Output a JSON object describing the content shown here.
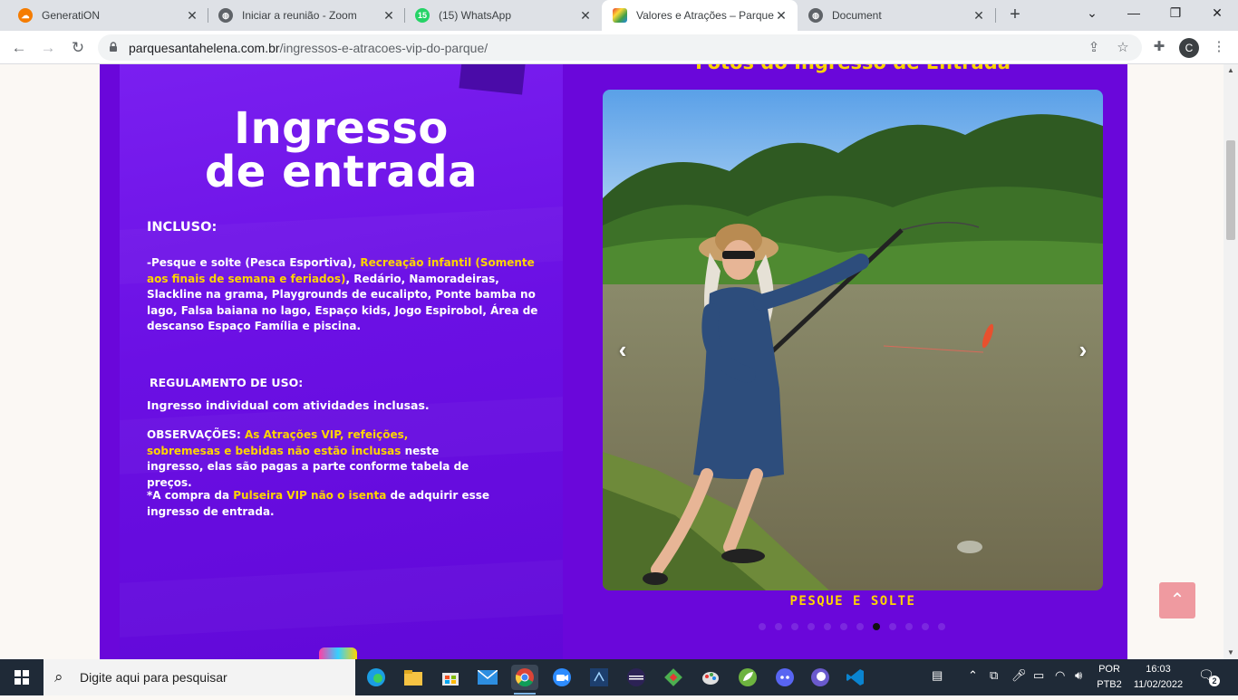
{
  "browser": {
    "tabs": [
      {
        "title": "GeneratiON",
        "icon": "cloud-icon",
        "color": "#f57c00"
      },
      {
        "title": "Iniciar a reunião - Zoom",
        "icon": "globe-icon",
        "color": "#5f6368"
      },
      {
        "title": "(15) WhatsApp",
        "icon": "whatsapp-icon",
        "color": "#25d366",
        "badge": "15"
      },
      {
        "title": "Valores e Atrações – Parque Sa",
        "icon": "park-logo-icon",
        "color": "#e53935"
      },
      {
        "title": "Document",
        "icon": "globe-icon",
        "color": "#5f6368"
      }
    ],
    "active_tab": 3,
    "new_tab_label": "+",
    "url_host": "parquesantahelena.com.br",
    "url_path": "/ingressos-e-atracoes-vip-do-parque/",
    "profile_initial": "C"
  },
  "page": {
    "photo_heading": "Fotos do Ingresso de Entrada",
    "promo": {
      "title_line1": "Ingresso",
      "title_line2": "de entrada",
      "incluso_heading": "INCLUSO:",
      "incluso_p1": "-Pesque e solte ",
      "incluso_p2": "(Pesca Esportiva)",
      "incluso_p3": ", ",
      "incluso_p4": "Recreação infantil",
      "incluso_p5": "(Somente aos finais de semana e feriados)",
      "incluso_p6": ", Redário, Namoradeiras, Slackline na grama, Playgrounds de eucalipto, Ponte bamba no lago, Falsa baiana no lago, Espaço kids, Jogo Espirobol, Área de descanso ",
      "incluso_p7": "Espaço Família",
      "incluso_p8": " e piscina.",
      "regulamento_heading": "REGULAMENTO DE USO:",
      "regulamento_text": "Ingresso individual com atividades inclusas.",
      "obs_label": "OBSERVAÇÕES: ",
      "obs_hl": "As Atrações VIP, refeições, sobremesas e bebidas não estão inclusas",
      "obs_rest": " neste ingresso, elas são pagas a parte conforme tabela de preços.",
      "compra_p1": "*A compra da ",
      "compra_hl1": "Pulseira VIP",
      "compra_p2": " ",
      "compra_hl2": "não o isenta",
      "compra_p3": " de adquirir esse ingresso de entrada."
    },
    "carousel": {
      "caption": "PESQUE E SOLTE",
      "prev": "‹",
      "next": "›",
      "dot_count": 12,
      "active_dot": 7
    },
    "back_to_top": "⌃"
  },
  "taskbar": {
    "search_placeholder": "Digite aqui para pesquisar",
    "lang_line1": "POR",
    "lang_line2": "PTB2",
    "time": "16:03",
    "date": "11/02/2022",
    "notifications": "2"
  }
}
